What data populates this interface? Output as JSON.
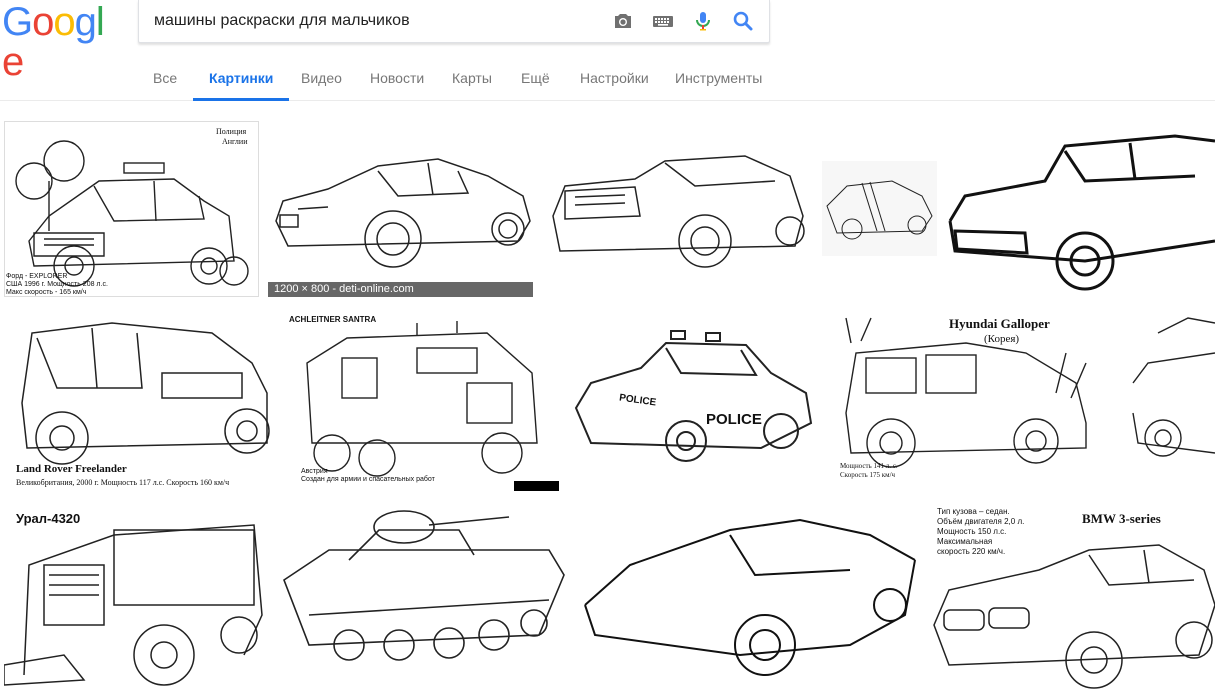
{
  "logo": {
    "letters": [
      "G",
      "o",
      "o",
      "g",
      "l",
      "e"
    ],
    "colors": [
      "#4285F4",
      "#EA4335",
      "#FBBC05",
      "#4285F4",
      "#34A853",
      "#EA4335"
    ]
  },
  "search": {
    "query": "машины раскраски для мальчиков"
  },
  "tabs": [
    "Все",
    "Картинки",
    "Видео",
    "Новости",
    "Карты",
    "Ещё",
    "Настройки",
    "Инструменты"
  ],
  "active_tab": "Картинки",
  "colors": {
    "accent": "#1a73e8",
    "tab_text": "#777777",
    "search_icon": "#4285F4",
    "mic_blue": "#4285F4",
    "mic_red": "#EA4335"
  },
  "images": [
    {
      "id": "police-explorer",
      "labels": [
        "Полиция",
        "Англии",
        "Форд - EXPLORER",
        "США 1996 г. Мощность 208 л.с.",
        "Макс скорость - 165 км/ч"
      ]
    },
    {
      "id": "bmw-6-coupe",
      "caption": "1200 × 800 - deti-online.com"
    },
    {
      "id": "cadillac-convertible",
      "labels": []
    },
    {
      "id": "ford-gt",
      "labels": []
    },
    {
      "id": "classic-chevrolet",
      "labels": []
    },
    {
      "id": "land-rover-freelander",
      "labels": [
        "Land Rover Freelander",
        "Великобритания, 2000 г. Мощность 117 л.с. Скорость 160 км/ч"
      ]
    },
    {
      "id": "achleitner-santra",
      "labels": [
        "ACHLEITNER SANTRA",
        "Австрия",
        "Создан для армии и спасательных работ"
      ]
    },
    {
      "id": "police-cartoon",
      "labels": [
        "POLICE",
        "POLICE"
      ]
    },
    {
      "id": "hyundai-galloper",
      "labels": [
        "Hyundai Galloper",
        "(Корея)",
        "Мощность 141 л. с.",
        "Скорость 175 км/ч"
      ]
    },
    {
      "id": "lamborghini-partial",
      "labels": []
    },
    {
      "id": "ural-4320",
      "labels": [
        "Урал-4320"
      ]
    },
    {
      "id": "t-34-tank",
      "labels": []
    },
    {
      "id": "ferrari-enzo",
      "labels": []
    },
    {
      "id": "bmw-3-series",
      "labels": [
        "Тип кузова – седан.",
        "Объём двигателя 2,0 л.",
        "Мощность 150 л.с.",
        "Максимальная",
        "скорость 220 км/ч.",
        "BMW 3-series"
      ]
    }
  ]
}
